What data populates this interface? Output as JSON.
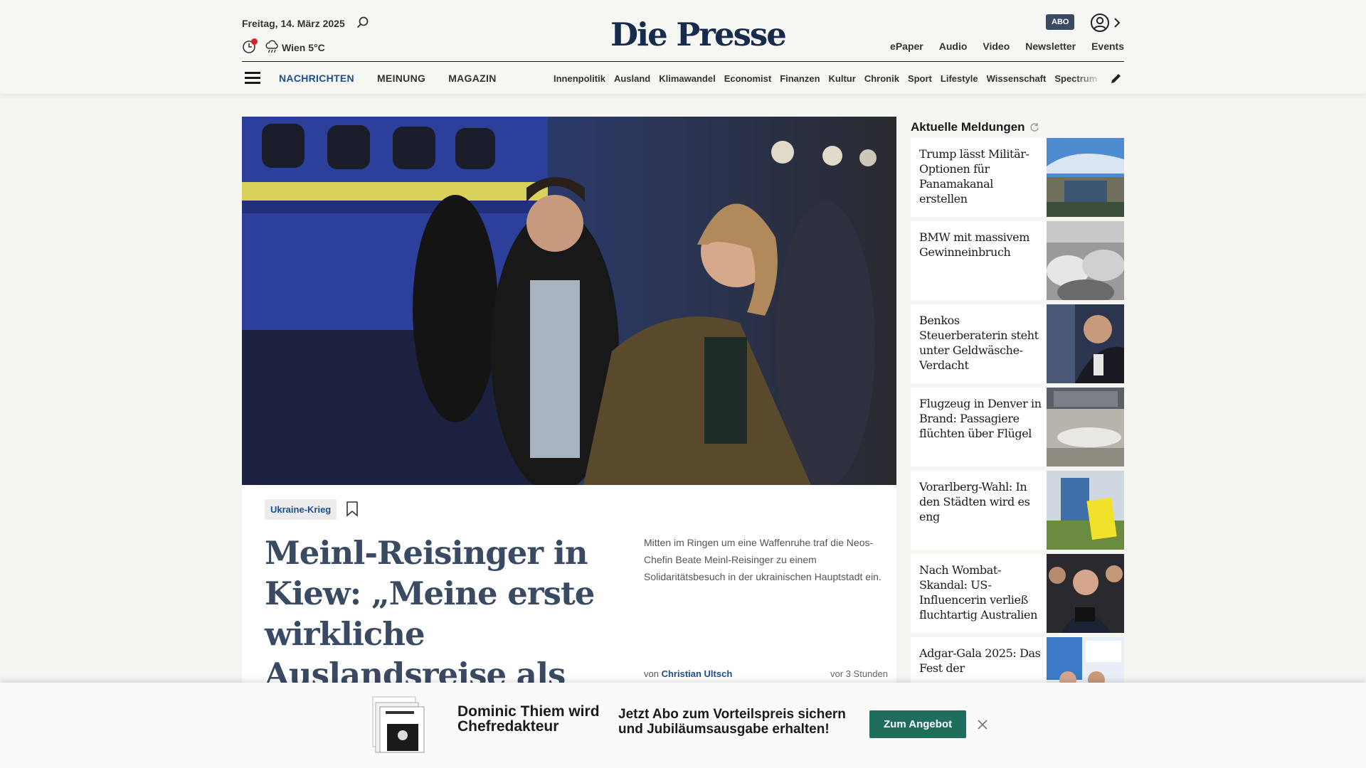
{
  "header": {
    "date": "Freitag, 14. März 2025",
    "weather": "Wien 5°C",
    "logo": "Die Presse",
    "abo": "ABO",
    "links": [
      "ePaper",
      "Audio",
      "Video",
      "Newsletter",
      "Events"
    ]
  },
  "nav": {
    "main": [
      "NACHRICHTEN",
      "MEINUNG",
      "MAGAZIN"
    ],
    "active": "NACHRICHTEN",
    "sub": [
      "Innenpolitik",
      "Ausland",
      "Klimawandel",
      "Economist",
      "Finanzen",
      "Kultur",
      "Chronik",
      "Sport",
      "Lifestyle",
      "Wissenschaft",
      "Spectrum"
    ]
  },
  "lead": {
    "tag": "Ukraine-Krieg",
    "headline": "Meinl-Reisinger in Kiew: „Meine erste wirkliche Auslandsreise als Außenministerin“",
    "teaser": "Mitten im Ringen um eine Waffenruhe traf die Neos-Chefin Beate Meinl-Reisinger zu einem Solidaritätsbesuch in der ukrainischen Hauptstadt ein.",
    "byline_prefix": "von",
    "author": "Christian Ultsch",
    "time": "vor 3 Stunden"
  },
  "sidebar": {
    "title": "Aktuelle Meldungen",
    "items": [
      {
        "title": "Trump lässt Militär-Optionen für Panamakanal erstellen"
      },
      {
        "title": "BMW mit massivem Gewinneinbruch"
      },
      {
        "title": "Benkos Steuerberaterin steht unter Geldwäsche-Verdacht"
      },
      {
        "title": "Flugzeug in Denver in Brand: Passagiere flüchten über Flügel"
      },
      {
        "title": "Vorarlberg-Wahl: In den Städten wird es eng"
      },
      {
        "title": "Nach Wombat-Skandal: US-Influencerin verließ fluchtartig Australien"
      },
      {
        "title": "Adgar-Gala 2025: Das Fest der"
      }
    ]
  },
  "banner": {
    "name": "Dominic Thiem wird Chefredakteur",
    "offer": "Jetzt Abo zum Vorteilspreis sichern und Jubiläumsausgabe erhalten!",
    "cta": "Zum Angebot"
  },
  "colors": {
    "brand": "#172b4d",
    "link": "#1b4f8f",
    "cta": "#1f6e5c",
    "alert": "#d8232a"
  }
}
